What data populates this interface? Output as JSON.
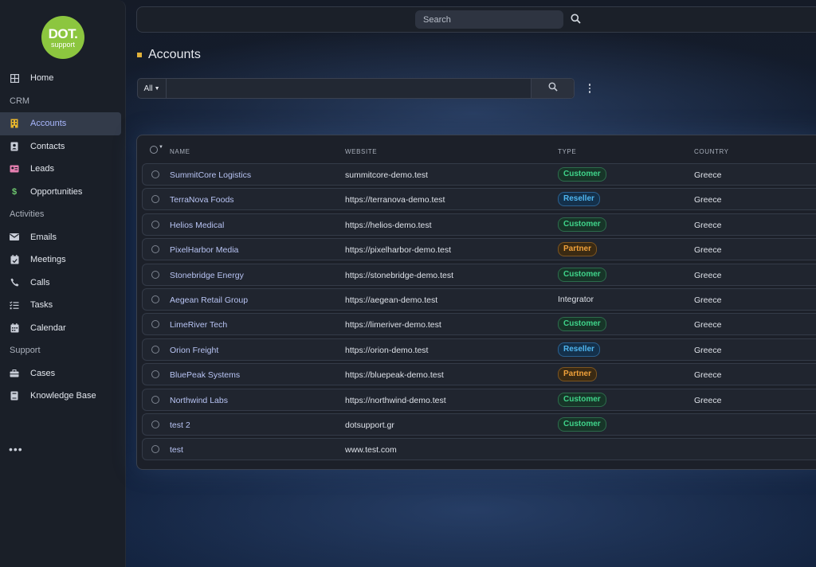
{
  "logo": {
    "line1": "DOT.",
    "line2": "support"
  },
  "sidebar": {
    "home": "Home",
    "crm_label": "CRM",
    "crm_items": [
      "Accounts",
      "Contacts",
      "Leads",
      "Opportunities"
    ],
    "activities_label": "Activities",
    "activity_items": [
      "Emails",
      "Meetings",
      "Calls",
      "Tasks",
      "Calendar"
    ],
    "support_label": "Support",
    "support_items": [
      "Cases",
      "Knowledge Base"
    ],
    "more": "•••"
  },
  "topbar": {
    "search_placeholder": "Search"
  },
  "page": {
    "title": "Accounts"
  },
  "filter": {
    "scope": "All",
    "value": ""
  },
  "table": {
    "headers": [
      "NAME",
      "WEBSITE",
      "TYPE",
      "COUNTRY"
    ],
    "rows": [
      {
        "name": "SummitCore Logistics",
        "website": "summitcore-demo.test",
        "type": "Customer",
        "country": "Greece"
      },
      {
        "name": "TerraNova Foods",
        "website": "https://terranova-demo.test",
        "type": "Reseller",
        "country": "Greece"
      },
      {
        "name": "Helios Medical",
        "website": "https://helios-demo.test",
        "type": "Customer",
        "country": "Greece"
      },
      {
        "name": "PixelHarbor Media",
        "website": "https://pixelharbor-demo.test",
        "type": "Partner",
        "country": "Greece"
      },
      {
        "name": "Stonebridge Energy",
        "website": "https://stonebridge-demo.test",
        "type": "Customer",
        "country": "Greece"
      },
      {
        "name": "Aegean Retail Group",
        "website": "https://aegean-demo.test",
        "type": "Integrator",
        "country": "Greece"
      },
      {
        "name": "LimeRiver Tech",
        "website": "https://limeriver-demo.test",
        "type": "Customer",
        "country": "Greece"
      },
      {
        "name": "Orion Freight",
        "website": "https://orion-demo.test",
        "type": "Reseller",
        "country": "Greece"
      },
      {
        "name": "BluePeak Systems",
        "website": "https://bluepeak-demo.test",
        "type": "Partner",
        "country": "Greece"
      },
      {
        "name": "Northwind Labs",
        "website": "https://northwind-demo.test",
        "type": "Customer",
        "country": "Greece"
      },
      {
        "name": "test 2",
        "website": "dotsupport.gr",
        "type": "Customer",
        "country": ""
      },
      {
        "name": "test",
        "website": "www.test.com",
        "type": "",
        "country": ""
      }
    ]
  },
  "colors": {
    "accent": "#e0b13a",
    "logo_green": "#8cc63f",
    "customer": "#3fd48a",
    "reseller": "#4fb6f0",
    "partner": "#f0a13a"
  }
}
